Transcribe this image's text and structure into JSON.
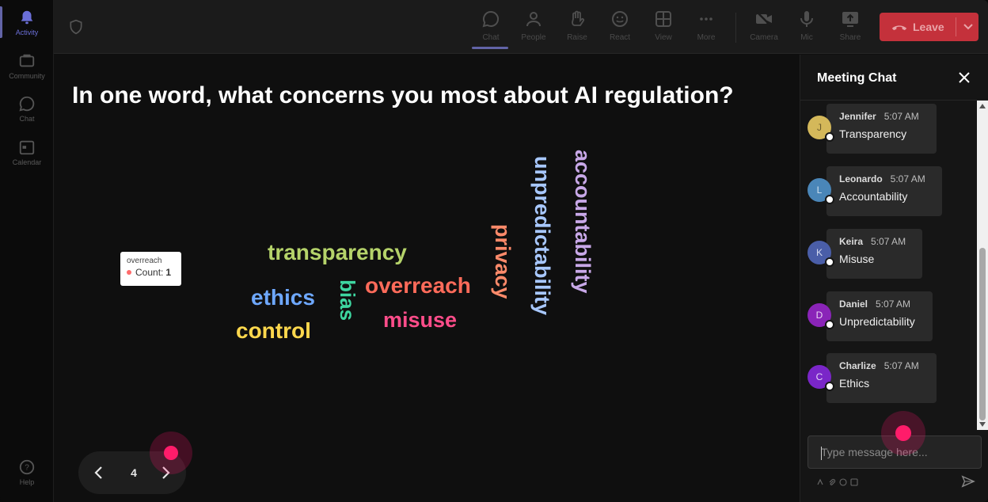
{
  "rail": {
    "items": [
      {
        "label": "Activity",
        "icon": "bell-icon",
        "active": true
      },
      {
        "label": "Community",
        "icon": "community-icon",
        "active": false
      },
      {
        "label": "Chat",
        "icon": "chat-icon",
        "active": false
      },
      {
        "label": "Calendar",
        "icon": "calendar-icon",
        "active": false
      }
    ],
    "help_label": "Help"
  },
  "toolbar": {
    "chat": "Chat",
    "people": "People",
    "raise": "Raise",
    "react": "React",
    "view": "View",
    "more": "More",
    "camera": "Camera",
    "mic": "Mic",
    "share": "Share",
    "leave": "Leave"
  },
  "stage": {
    "question": "In one word, what concerns you most about AI regulation?",
    "words": [
      {
        "text": "transparency",
        "color": "#b5d36a"
      },
      {
        "text": "ethics",
        "color": "#6ea8ff"
      },
      {
        "text": "control",
        "color": "#ffd84d"
      },
      {
        "text": "bias",
        "color": "#3ed6a0"
      },
      {
        "text": "overreach",
        "color": "#ff6b5a"
      },
      {
        "text": "misuse",
        "color": "#ff4d8a"
      },
      {
        "text": "privacy",
        "color": "#ff8a6a"
      },
      {
        "text": "unpredictability",
        "color": "#a8c8ff"
      },
      {
        "text": "accountability",
        "color": "#c8a8e8"
      }
    ],
    "tooltip": {
      "title": "overreach",
      "label": "Count:",
      "value": "1"
    },
    "pager": {
      "page": "4"
    }
  },
  "chat": {
    "title": "Meeting Chat",
    "messages": [
      {
        "initial": "J",
        "name": "Jennifer",
        "time": "5:07 AM",
        "text": "Transparency",
        "avatar_color": "#d4b85a"
      },
      {
        "initial": "L",
        "name": "Leonardo",
        "time": "5:07 AM",
        "text": "Accountability",
        "avatar_color": "#4a86b8"
      },
      {
        "initial": "K",
        "name": "Keira",
        "time": "5:07 AM",
        "text": "Misuse",
        "avatar_color": "#4a5ea8"
      },
      {
        "initial": "D",
        "name": "Daniel",
        "time": "5:07 AM",
        "text": "Unpredictability",
        "avatar_color": "#8a24b8"
      },
      {
        "initial": "C",
        "name": "Charlize",
        "time": "5:07 AM",
        "text": "Ethics",
        "avatar_color": "#7a26c8"
      }
    ],
    "compose_placeholder": "Type message here..."
  }
}
